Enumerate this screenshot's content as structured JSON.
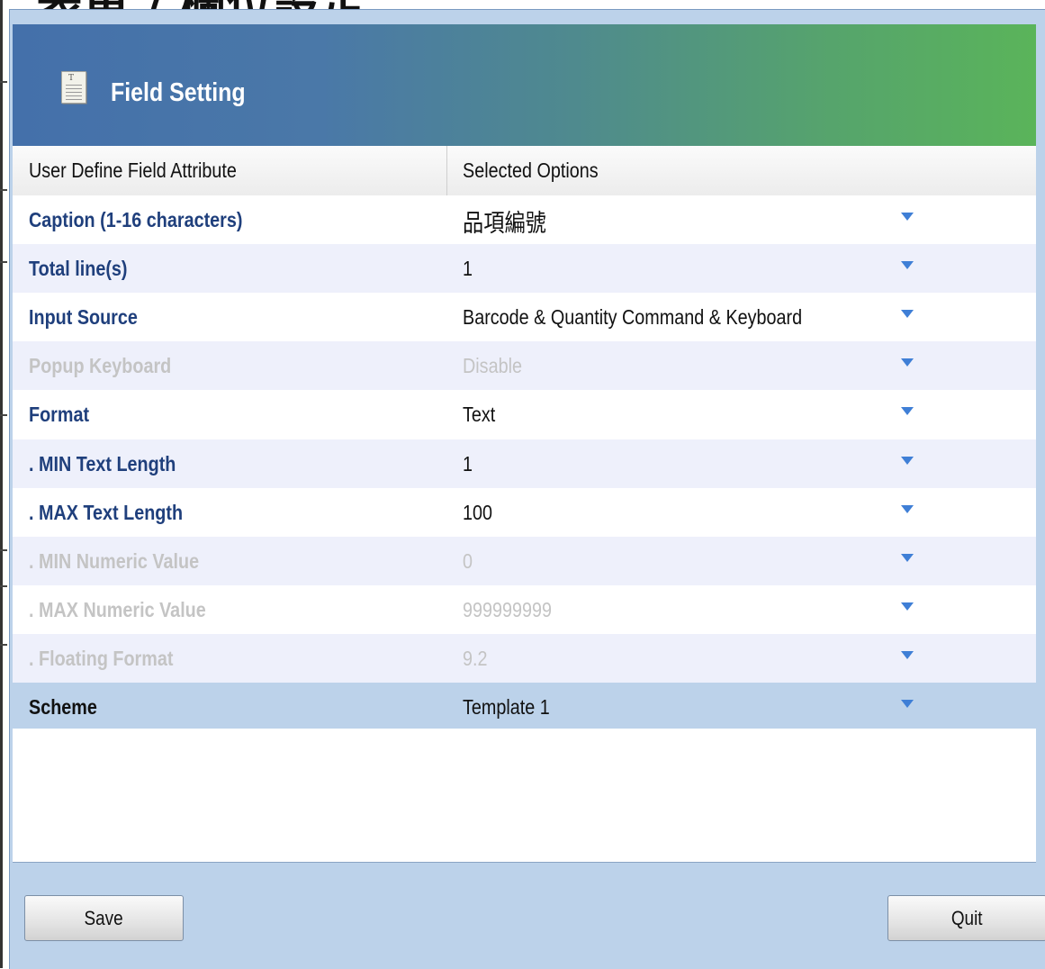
{
  "page": {
    "heading": "表單 / 欄位設定"
  },
  "dialog": {
    "title": "Field Setting",
    "icon": "document-icon"
  },
  "table": {
    "columns": [
      "User Define Field Attribute",
      "Selected Options"
    ],
    "rows": [
      {
        "attribute": "Caption (1-16 characters)",
        "value": "品項編號",
        "enabled": true
      },
      {
        "attribute": "Total line(s)",
        "value": "1",
        "enabled": true
      },
      {
        "attribute": "Input Source",
        "value": "Barcode & Quantity Command & Keyboard",
        "enabled": true
      },
      {
        "attribute": "Popup Keyboard",
        "value": "Disable",
        "enabled": false
      },
      {
        "attribute": "Format",
        "value": "Text",
        "enabled": true
      },
      {
        "attribute": ". MIN Text Length",
        "value": "1",
        "enabled": true
      },
      {
        "attribute": ". MAX Text Length",
        "value": "100",
        "enabled": true
      },
      {
        "attribute": ". MIN Numeric Value",
        "value": "0",
        "enabled": false
      },
      {
        "attribute": ". MAX Numeric Value",
        "value": "999999999",
        "enabled": false
      },
      {
        "attribute": ". Floating Format",
        "value": "9.2",
        "enabled": false
      },
      {
        "attribute": "Scheme",
        "value": "Template 1",
        "enabled": true,
        "selected": true
      }
    ]
  },
  "buttons": {
    "save": "Save",
    "quit": "Quit"
  },
  "colors": {
    "header_start": "#4470aa",
    "header_end": "#5ab45a",
    "attribute_text": "#1f3f7c",
    "disabled_text": "#c4c4c4",
    "dropdown_arrow": "#3f7fd6",
    "selected_row": "#bcd2ea"
  }
}
